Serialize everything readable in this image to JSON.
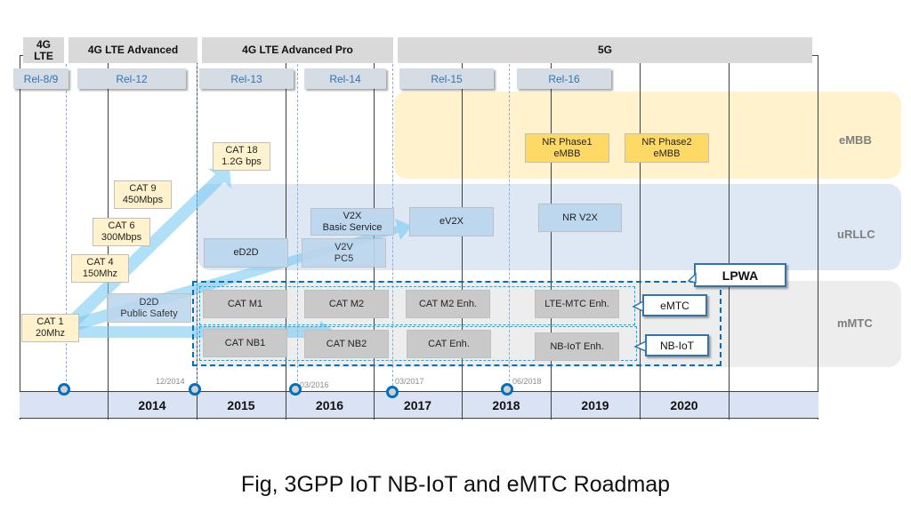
{
  "phases": [
    {
      "label": "4G\nLTE"
    },
    {
      "label": "4G LTE Advanced"
    },
    {
      "label": "4G LTE Advanced Pro"
    },
    {
      "label": "5G"
    }
  ],
  "releases": [
    "Rel-8/9",
    "Rel-12",
    "Rel-13",
    "Rel-14",
    "Rel-15",
    "Rel-16"
  ],
  "bands": {
    "embb": "eMBB",
    "urllc": "uRLLC",
    "mmtc": "mMTC"
  },
  "lte_categories": [
    {
      "name": "CAT 1",
      "rate": "20Mhz"
    },
    {
      "name": "CAT 4",
      "rate": "150Mhz"
    },
    {
      "name": "CAT 6",
      "rate": "300Mbps"
    },
    {
      "name": "CAT 9",
      "rate": "450Mbps"
    },
    {
      "name": "CAT 18",
      "rate": "1.2G bps"
    }
  ],
  "embb_items": [
    {
      "line1": "NR Phase1",
      "line2": "eMBB"
    },
    {
      "line1": "NR Phase2",
      "line2": "eMBB"
    }
  ],
  "urllc_items": {
    "d2d": {
      "line1": "D2D",
      "line2": "Public Safety"
    },
    "ed2d": "eD2D",
    "v2x_basic": {
      "line1": "V2X",
      "line2": "Basic Service"
    },
    "v2v": {
      "line1": "V2V",
      "line2": "PC5"
    },
    "ev2x": "eV2X",
    "nr_v2x": "NR V2X"
  },
  "emtc_row": [
    "CAT M1",
    "CAT M2",
    "CAT M2 Enh.",
    "LTE-MTC Enh."
  ],
  "nbiot_row": [
    "CAT NB1",
    "CAT NB2",
    "CAT Enh.",
    "NB-IoT Enh."
  ],
  "callouts": {
    "lpwa": "LPWA",
    "emtc": "eMTC",
    "nbiot": "NB-IoT"
  },
  "milestones": [
    "12/2014",
    "03/2016",
    "03/2017",
    "06/2018"
  ],
  "years": [
    "",
    "2014",
    "2015",
    "2016",
    "2017",
    "2018",
    "2019",
    "2020",
    ""
  ],
  "caption": "Fig, 3GPP IoT NB-IoT and eMTC Roadmap",
  "colors": {
    "embb_band": "#fff2cc",
    "urllc_band": "#dee8f5",
    "mmtc_band": "#ededed",
    "accent_blue": "#0070c0",
    "arrow_blue": "#8fd3f4"
  }
}
